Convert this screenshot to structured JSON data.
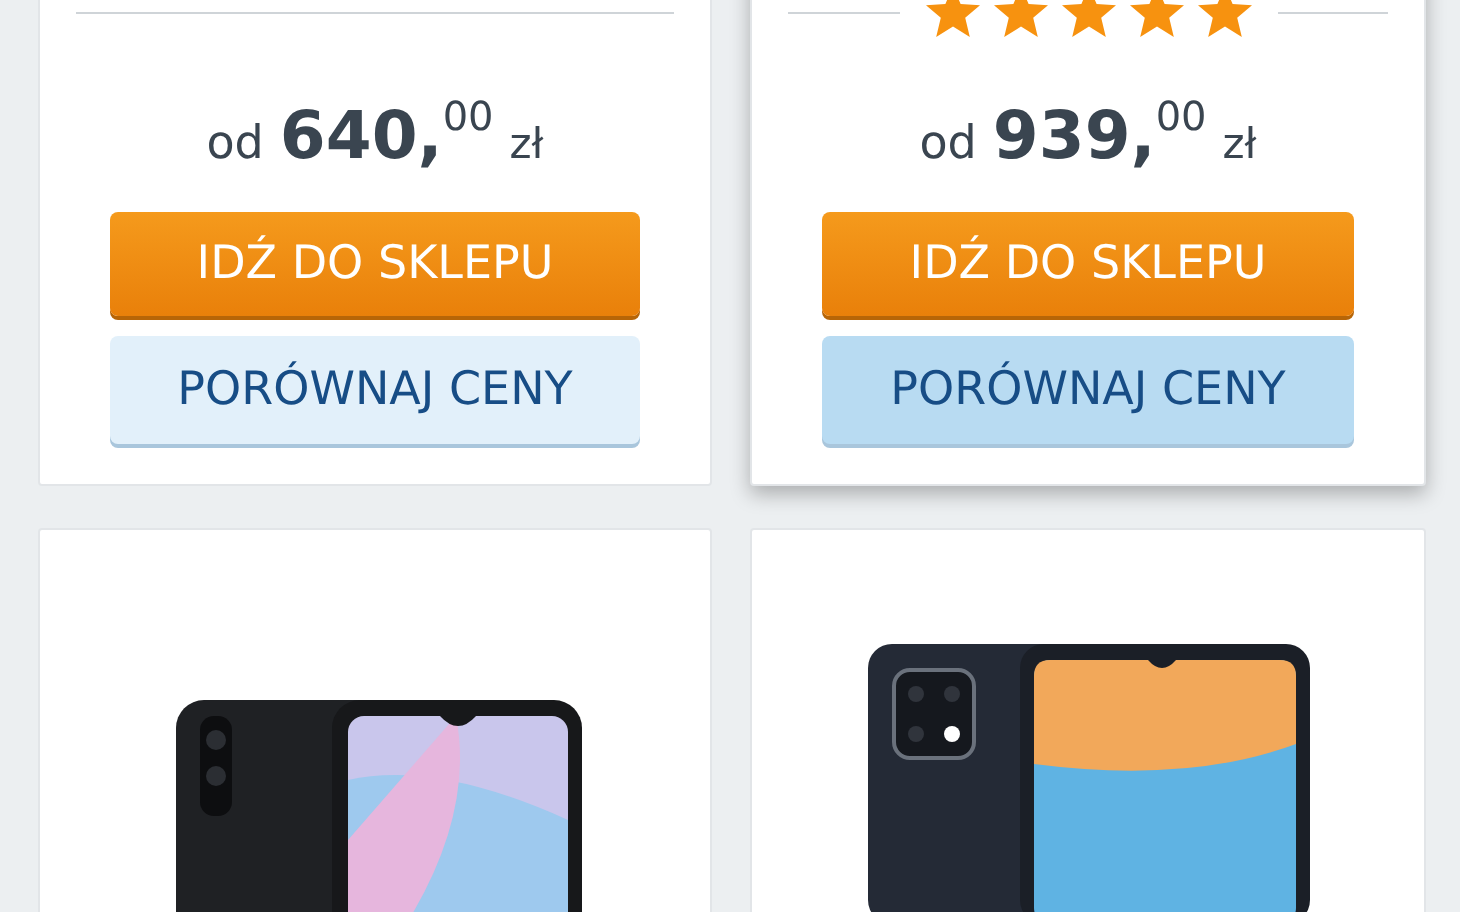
{
  "cards": [
    {
      "kind": "offer",
      "highlighted": false,
      "price": {
        "prefix": "od",
        "amount": "640,",
        "cents": "00",
        "currency": "zł"
      },
      "shop_button": "IDŹ DO SKLEPU",
      "compare_button": "PORÓWNAJ CENY"
    },
    {
      "kind": "offer",
      "highlighted": true,
      "stars": 5,
      "price": {
        "prefix": "od",
        "amount": "939,",
        "cents": "00",
        "currency": "zł"
      },
      "shop_button": "IDŹ DO SKLEPU",
      "compare_button": "PORÓWNAJ CENY"
    },
    {
      "kind": "product_photo",
      "highlighted": false
    },
    {
      "kind": "product_photo",
      "highlighted": false
    }
  ]
}
